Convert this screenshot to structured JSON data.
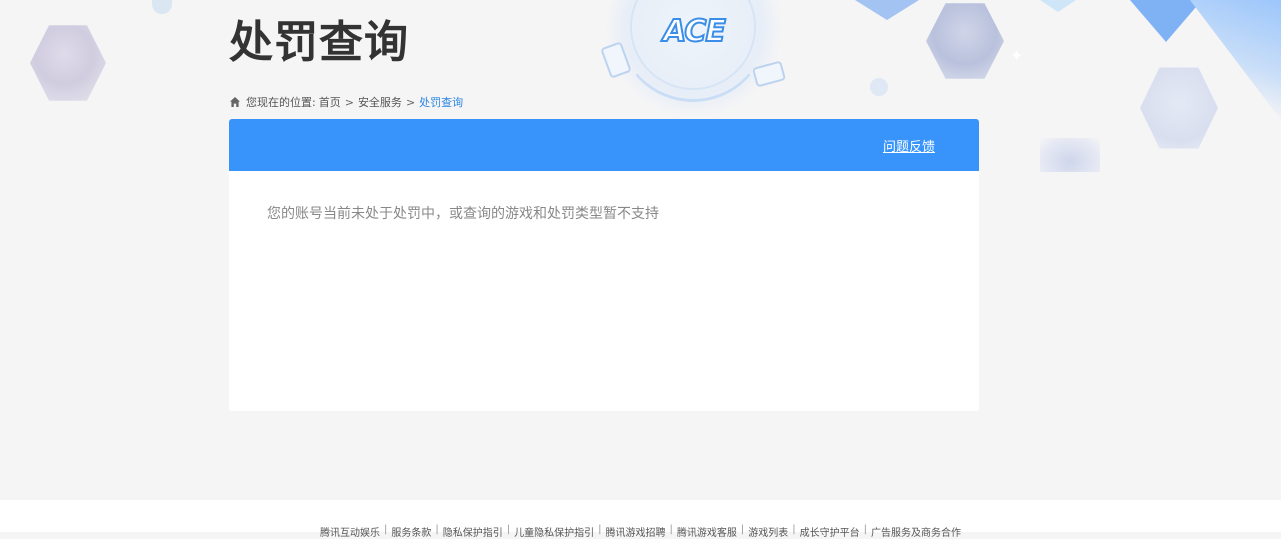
{
  "page": {
    "title": "处罚查询",
    "emblem_text": "ACE"
  },
  "breadcrumb": {
    "prefix": "您现在的位置:",
    "items": [
      "首页",
      "安全服务",
      "处罚查询"
    ],
    "separator": ">",
    "icon": "home-icon"
  },
  "panel": {
    "header_color": "#3894fb",
    "feedback_label": "问题反馈",
    "message": "您的账号当前未处于处罚中，或查询的游戏和处罚类型暂不支持"
  },
  "footer": {
    "links": [
      "腾讯互动娱乐",
      "服务条款",
      "隐私保护指引",
      "儿童隐私保护指引",
      "腾讯游戏招聘",
      "腾讯游戏客服",
      "游戏列表",
      "成长守护平台",
      "广告服务及商务合作"
    ],
    "separator": "|"
  },
  "colors": {
    "accent": "#3894fb",
    "breadcrumb_current": "#2a86e0",
    "background": "#f5f5f6"
  }
}
